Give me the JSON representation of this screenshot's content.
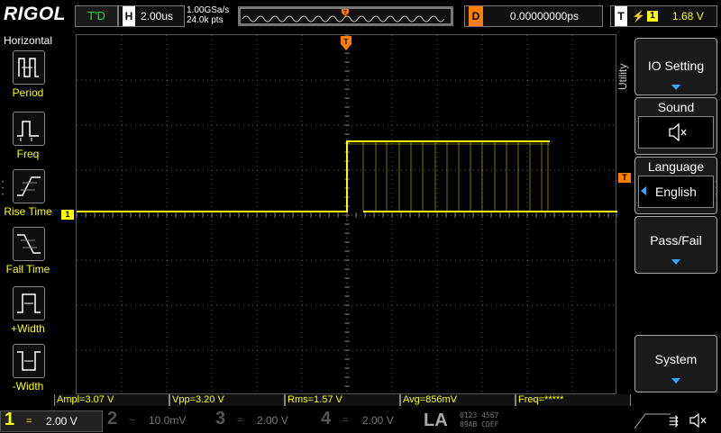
{
  "top": {
    "brand": "RIGOL",
    "run_status": "T'D",
    "horizontal_label": "H",
    "timebase": "2.00us",
    "sample_rate": "1.00GSa/s",
    "memory_depth": "24.0k pts",
    "trigger_marker": "T",
    "delay_label": "D",
    "delay_value": "0.00000000ps",
    "trigger_label": "T",
    "trigger_channel": "1",
    "trigger_level": "1.68 V"
  },
  "left_menu": {
    "title": "Horizontal",
    "items": [
      {
        "label": "Period",
        "icon": "period-icon"
      },
      {
        "label": "Freq",
        "icon": "frequency-icon"
      },
      {
        "label": "Rise Time",
        "icon": "rise-time-icon"
      },
      {
        "label": "Fall Time",
        "icon": "fall-time-icon"
      },
      {
        "label": "+Width",
        "icon": "positive-width-icon"
      },
      {
        "label": "-Width",
        "icon": "negative-width-icon"
      }
    ]
  },
  "right_menu": {
    "section": "Utility",
    "io_setting": "IO Setting",
    "sound": "Sound",
    "language": "Language",
    "language_value": "English",
    "pass_fail": "Pass/Fail",
    "system": "System"
  },
  "measurements": [
    {
      "label": "Ampl=3.07 V"
    },
    {
      "label": "Vpp=3.20 V"
    },
    {
      "label": "Rms=1.57 V"
    },
    {
      "label": "Avg=856mV"
    },
    {
      "label": "Freq=*****"
    }
  ],
  "channels": [
    {
      "num": "1",
      "coupling": "=",
      "scale": "2.00 V",
      "color": "#ffff00",
      "active": true
    },
    {
      "num": "2",
      "coupling": "~",
      "scale": "10.0mV",
      "color": "#00e0e0",
      "active": false
    },
    {
      "num": "3",
      "coupling": "=",
      "scale": "2.00 V",
      "color": "#e040e0",
      "active": false
    },
    {
      "num": "4",
      "coupling": "=",
      "scale": "2.00 V",
      "color": "#2080ff",
      "active": false
    }
  ],
  "la": {
    "label": "LA",
    "rows": [
      "0123 4567",
      "89AB CDEF"
    ]
  },
  "waveform": {
    "channel": "1",
    "color": "#ffff00",
    "ch1_marker": "1",
    "offset_marker": "T"
  },
  "colors": {
    "ch1": "#ffff00",
    "accent": "#ff7d00",
    "blue": "#37a6ff"
  }
}
